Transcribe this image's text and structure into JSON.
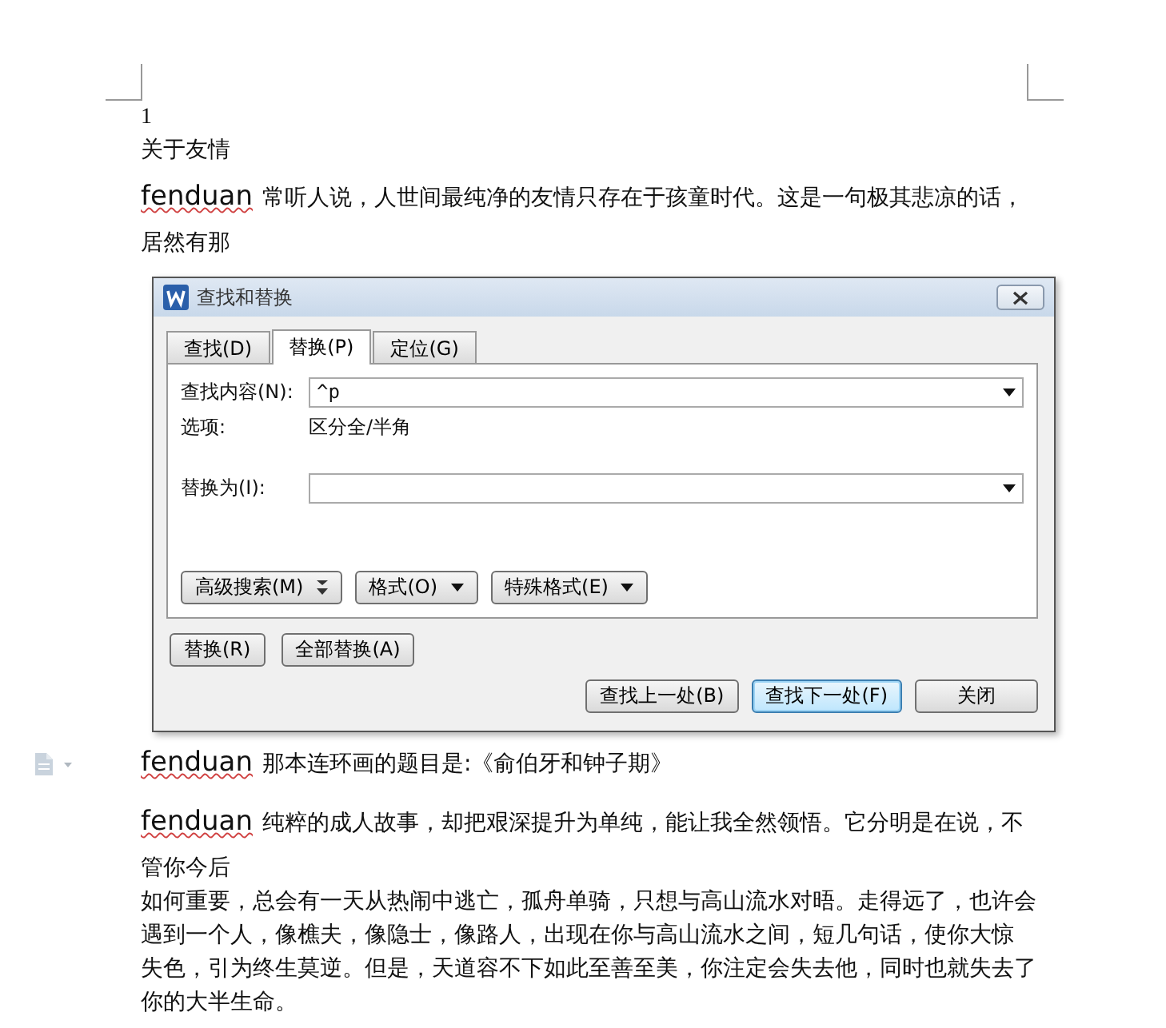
{
  "document": {
    "top": [
      {
        "kind": "number",
        "text": "1"
      },
      {
        "kind": "line",
        "text": "关于友情"
      },
      {
        "kind": "para",
        "lead": "fenduan",
        "text": "常听人说，人世间最纯净的友情只存在于孩童时代。这是一句极其悲凉的话，"
      },
      {
        "kind": "line",
        "text": "居然有那"
      }
    ],
    "bottom": [
      {
        "kind": "para",
        "lead": "fenduan",
        "text": "那本连环画的题目是:《俞伯牙和钟子期》"
      },
      {
        "kind": "para",
        "lead": "fenduan",
        "text": "纯粹的成人故事，却把艰深提升为单纯，能让我全然领悟。它分明是在说，不"
      },
      {
        "kind": "line",
        "text": "管你今后"
      },
      {
        "kind": "line",
        "text": "如何重要，总会有一天从热闹中逃亡，孤舟单骑，只想与高山流水对晤。走得远了，也许会"
      },
      {
        "kind": "line",
        "text": "遇到一个人，像樵夫，像隐士，像路人，出现在你与高山流水之间，短几句话，使你大惊"
      },
      {
        "kind": "line",
        "text": "失色，引为终生莫逆。但是，天道容不下如此至善至美，你注定会失去他，同时也就失去了"
      },
      {
        "kind": "line",
        "text": "你的大半生命。"
      }
    ]
  },
  "dialog": {
    "title": "查找和替换",
    "tabs": [
      {
        "label": "查找(D)",
        "selected": false
      },
      {
        "label": "替换(P)",
        "selected": true
      },
      {
        "label": "定位(G)",
        "selected": false
      }
    ],
    "find": {
      "label": "查找内容(N):",
      "value": "^p"
    },
    "options": {
      "label": "选项:",
      "value": "区分全/半角"
    },
    "replace": {
      "label": "替换为(I):"
    },
    "search_buttons": [
      {
        "label": "高级搜索(M)",
        "kind": "expand"
      },
      {
        "label": "格式(O)",
        "kind": "menu"
      },
      {
        "label": "特殊格式(E)",
        "kind": "menu"
      }
    ],
    "replace_buttons": [
      "替换(R)",
      "全部替换(A)"
    ],
    "bottom_buttons": [
      {
        "label": "查找上一处(B)",
        "focused": false
      },
      {
        "label": "查找下一处(F)",
        "focused": true
      },
      {
        "label": "关闭",
        "focused": false
      }
    ]
  }
}
